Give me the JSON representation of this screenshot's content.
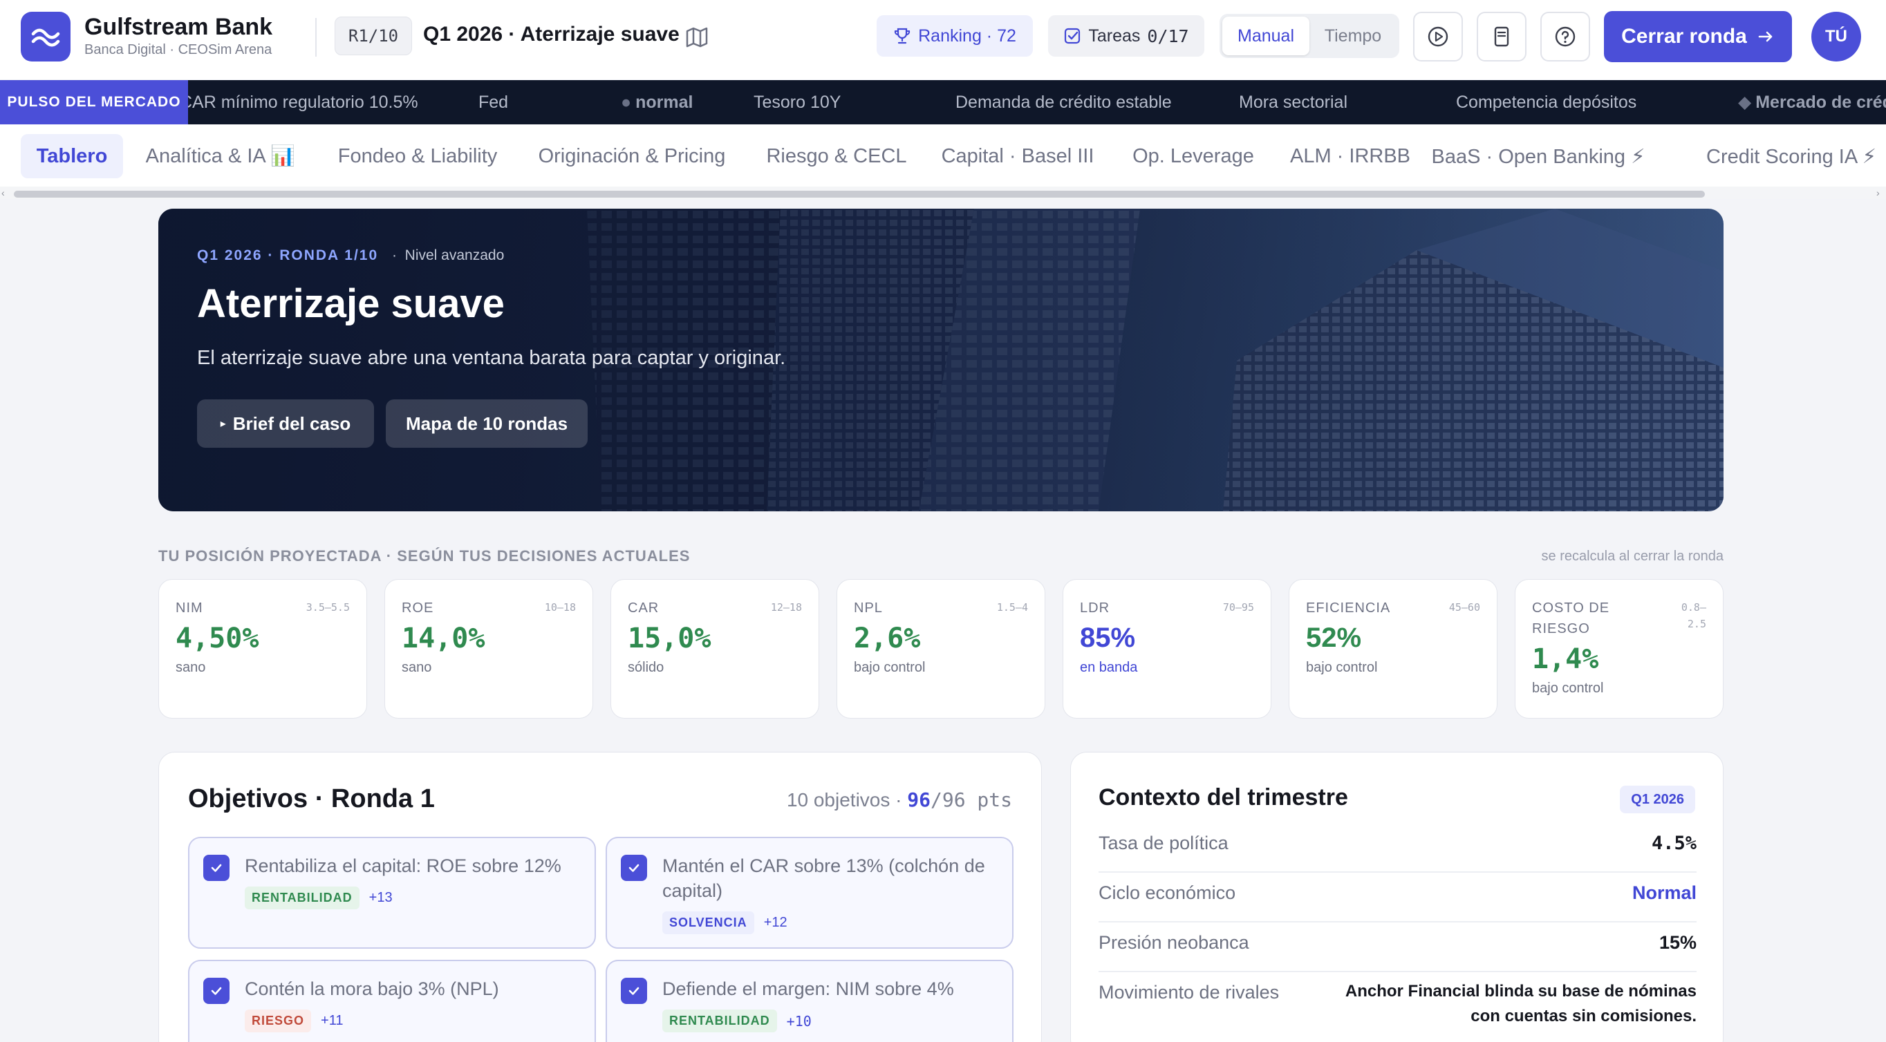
{
  "header": {
    "bank_name": "Gulfstream Bank",
    "bank_sub": "Banca Digital · CEOSim Arena",
    "round_pill": "R1/10",
    "scenario_title": "Q1 2026 · Aterrizaje suave",
    "ranking_label": "Ranking · 72",
    "tasks_label": "Tareas",
    "tasks_count": "0/17",
    "mode_manual": "Manual",
    "mode_time": "Tiempo",
    "close_round_label": "Cerrar ronda",
    "avatar_initials": "TÚ"
  },
  "ticker": {
    "label": "PULSO DEL MERCADO",
    "items": [
      "CAR mínimo regulatorio 10.5%",
      "Fed",
      "normal",
      "Tesoro 10Y",
      "Demanda de crédito estable",
      "Mora sectorial",
      "Competencia depósitos",
      "Mercado de créditos"
    ]
  },
  "tabs": [
    "Tablero",
    "Analítica & IA 📊",
    "Fondeo & Liability",
    "Originación & Pricing",
    "Riesgo & CECL",
    "Capital · Basel III",
    "Op. Leverage",
    "ALM · IRRBB",
    "BaaS · Open Banking ⚡",
    "Credit Scoring IA ⚡"
  ],
  "hero": {
    "kicker": "Q1 2026 · RONDA 1/10",
    "level": "Nivel avanzado",
    "title": "Aterrizaje suave",
    "subtitle": "El aterrizaje suave abre una ventana barata para captar y originar.",
    "brief_button": "Brief del caso",
    "map_button": "Mapa de 10 rondas"
  },
  "kpi_section": {
    "label": "TU POSICIÓN PROYECTADA · SEGÚN TUS DECISIONES ACTUALES",
    "note": "se recalcula al cerrar la ronda"
  },
  "kpis": [
    {
      "name": "NIM",
      "range": "3.5–5.5",
      "value": "4,50%",
      "status": "sano"
    },
    {
      "name": "ROE",
      "range": "10–18",
      "value": "14,0%",
      "status": "sano"
    },
    {
      "name": "CAR",
      "range": "12–18",
      "value": "15,0%",
      "status": "sólido"
    },
    {
      "name": "NPL",
      "range": "1.5–4",
      "value": "2,6%",
      "status": "bajo control"
    },
    {
      "name": "LDR",
      "range": "70–95",
      "value": "85%",
      "status": "en banda"
    },
    {
      "name": "EFICIENCIA",
      "range": "45–60",
      "value": "52%",
      "status": "bajo control"
    },
    {
      "name": "COSTO DE RIESGO",
      "range": "0.8–2.5",
      "value": "1,4%",
      "status": "bajo control"
    }
  ],
  "objectives": {
    "title": "Objetivos · Ronda 1",
    "count_label": "10 objetivos ·",
    "pts_earned": "96",
    "pts_total": "/96 pts",
    "items": [
      {
        "text": "Rentabiliza el capital: ROE sobre 12%",
        "tag": "RENTABILIDAD",
        "pts": "+13"
      },
      {
        "text": "Mantén el CAR sobre 13% (colchón de capital)",
        "tag": "SOLVENCIA",
        "pts": "+12"
      },
      {
        "text": "Contén la mora bajo 3% (NPL)",
        "tag": "RIESGO",
        "pts": "+11"
      },
      {
        "text": "Defiende el margen: NIM sobre 4%",
        "tag": "RENTABILIDAD",
        "pts": "+10"
      }
    ]
  },
  "context": {
    "title": "Contexto del trimestre",
    "badge": "Q1 2026",
    "rows": [
      {
        "label": "Tasa de política",
        "value": "4.5%"
      },
      {
        "label": "Ciclo económico",
        "value": "Normal"
      },
      {
        "label": "Presión neobanca",
        "value": "15%"
      },
      {
        "label": "Movimiento de rivales",
        "value": "Anchor Financial blinda su base de nóminas con cuentas sin comisiones."
      }
    ]
  },
  "colors": {
    "accent": "#4b4fd8",
    "healthy": "#2f8a4f",
    "ticker_bg": "#0f1729"
  }
}
